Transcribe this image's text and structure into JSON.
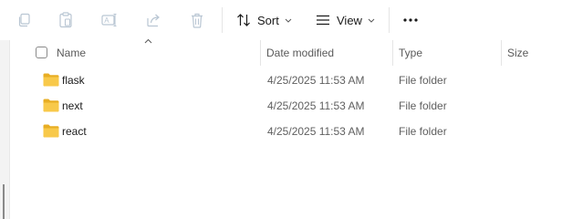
{
  "toolbar": {
    "copy_icon": "copy-icon",
    "paste_icon": "paste-icon",
    "rename_icon": "rename-icon",
    "share_icon": "share-icon",
    "delete_icon": "delete-icon",
    "sort_label": "Sort",
    "view_label": "View",
    "more_icon": "more-icon"
  },
  "columns": {
    "name": "Name",
    "date_modified": "Date modified",
    "type": "Type",
    "size": "Size"
  },
  "files": [
    {
      "name": "flask",
      "date_modified": "4/25/2025 11:53 AM",
      "type": "File folder",
      "size": ""
    },
    {
      "name": "next",
      "date_modified": "4/25/2025 11:53 AM",
      "type": "File folder",
      "size": ""
    },
    {
      "name": "react",
      "date_modified": "4/25/2025 11:53 AM",
      "type": "File folder",
      "size": ""
    }
  ],
  "colors": {
    "folder": "#F8C94A",
    "folder_dark": "#E8AE24",
    "icon_disabled": "#B9C6D3",
    "accent": "#005FB8"
  }
}
